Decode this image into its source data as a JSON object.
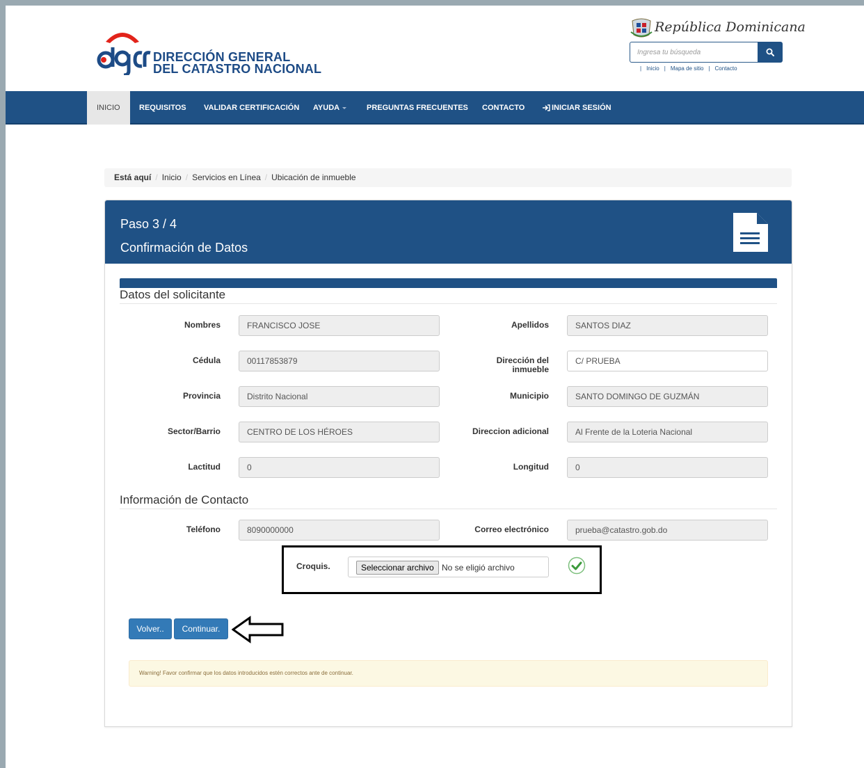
{
  "header": {
    "org_name_line1": "DIRECCIÓN GENERAL",
    "org_name_line2": "DEL CATASTRO NACIONAL",
    "gov_name": "República Dominicana",
    "search_placeholder": "Ingresa tu búsqueda",
    "top_links": [
      "Inicio",
      "Mapa de sitio",
      "Contacto"
    ]
  },
  "nav": {
    "items": [
      "INICIO",
      "REQUISITOS",
      "VALIDAR CERTIFICACIÓN",
      "AYUDA",
      "PREGUNTAS FRECUENTES",
      "CONTACTO",
      "INICIAR SESIÓN"
    ]
  },
  "breadcrumb": {
    "here": "Está aquí",
    "items": [
      "Inicio",
      "Servicios en Línea",
      "Ubicación de inmueble"
    ]
  },
  "panel": {
    "step": "Paso 3 / 4",
    "title": "Confirmación de Datos"
  },
  "applicant": {
    "section_title": "Datos del solicitante",
    "fields": {
      "nombres": {
        "label": "Nombres",
        "value": "FRANCISCO JOSE"
      },
      "apellidos": {
        "label": "Apellidos",
        "value": "SANTOS DIAZ"
      },
      "cedula": {
        "label": "Cédula",
        "value": "00117853879"
      },
      "direccion_l1": {
        "label": "Dirección del"
      },
      "direccion_l2": {
        "label": "inmueble"
      },
      "direccion": {
        "value": "C/ PRUEBA"
      },
      "provincia": {
        "label": "Provincia",
        "value": "Distrito Nacional"
      },
      "municipio": {
        "label": "Municipio",
        "value": "SANTO DOMINGO DE GUZMÁN"
      },
      "sector": {
        "label": "Sector/Barrio",
        "value": "CENTRO DE LOS HÉROES"
      },
      "direccion_adicional": {
        "label": "Direccion adicional",
        "value": "Al Frente de la Loteria Nacional"
      },
      "lactitud": {
        "label": "Lactitud",
        "value": "0"
      },
      "longitud": {
        "label": "Longitud",
        "value": "0"
      }
    }
  },
  "contact": {
    "section_title": "Información de Contacto",
    "telefono": {
      "label": "Teléfono",
      "value": "8090000000"
    },
    "correo": {
      "label": "Correo electrónico",
      "value": "prueba@catastro.gob.do"
    }
  },
  "croquis": {
    "label": "Croquis.",
    "button_label": "Seleccionar archivo",
    "status": "No se eligió archivo"
  },
  "actions": {
    "back_label": "Volver..",
    "continue_label": "Continuar."
  },
  "warning": "Warning! Favor confirmar que los datos introducidos estén correctos ante de continuar.",
  "colors": {
    "brand_blue": "#1f5185",
    "button_blue": "#337ab7",
    "check_green": "#3c9a3c"
  }
}
